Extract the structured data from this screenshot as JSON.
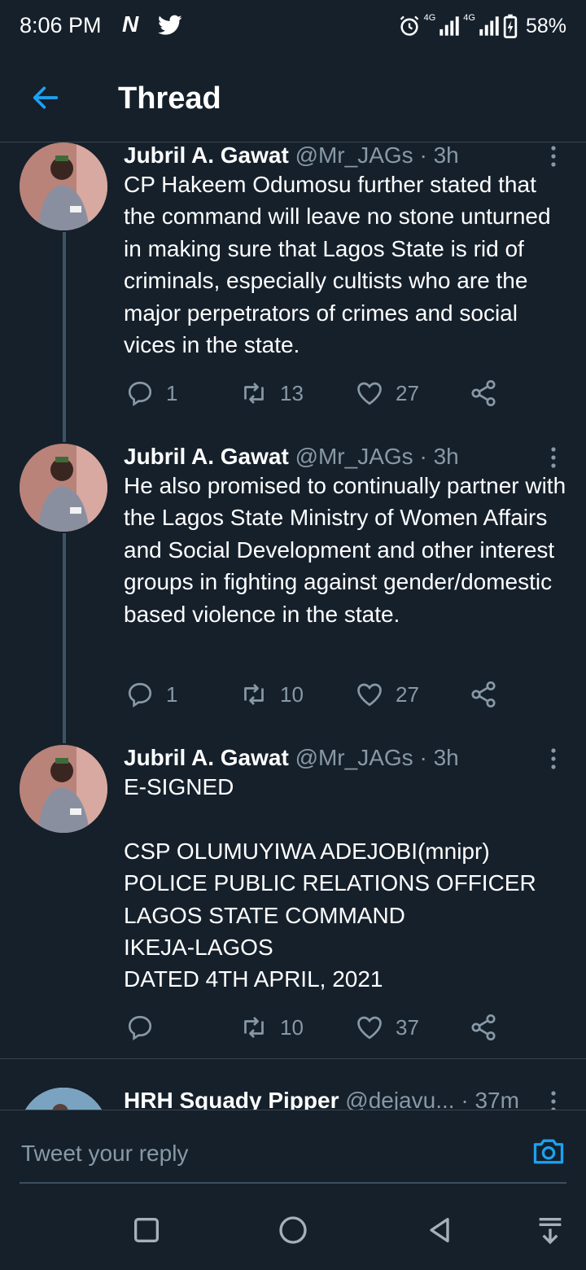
{
  "status_bar": {
    "time": "8:06 PM",
    "notif_n": "N",
    "net1": "4G",
    "net2": "4G",
    "battery": "58%"
  },
  "header": {
    "title": "Thread"
  },
  "tweets": [
    {
      "name": "Jubril A. Gawat",
      "handle": "@Mr_JAGs",
      "time": "3h",
      "text": "CP Hakeem Odumosu further stated that the command will leave no stone unturned in making sure that Lagos State is rid of criminals, especially cultists who are the major perpetrators of crimes and social vices in the state.",
      "replies": "1",
      "retweets": "13",
      "likes": "27"
    },
    {
      "name": "Jubril A. Gawat",
      "handle": "@Mr_JAGs",
      "time": "3h",
      "text": "He also promised to continually partner with the Lagos State Ministry of Women Affairs and Social Development and other interest groups in fighting against gender/domestic based violence in the state.",
      "replies": "1",
      "retweets": "10",
      "likes": "27"
    },
    {
      "name": "Jubril A. Gawat",
      "handle": "@Mr_JAGs",
      "time": "3h",
      "text": "E-SIGNED\n\nCSP OLUMUYIWA ADEJOBI(mnipr)\nPOLICE PUBLIC RELATIONS OFFICER\nLAGOS STATE COMMAND\nIKEJA-LAGOS\nDATED 4TH APRIL, 2021",
      "replies": "",
      "retweets": "10",
      "likes": "37"
    },
    {
      "name": "HRH Squady Pipper",
      "handle": "@dejavu...",
      "time": "37m"
    }
  ],
  "reply": {
    "placeholder": "Tweet your reply"
  },
  "colors": {
    "background": "#15202b",
    "accent": "#1da1f2",
    "muted": "#8899a6",
    "thread_line": "#3d5466"
  },
  "icons": [
    "back-arrow-icon",
    "more-vertical-icon",
    "reply-icon",
    "retweet-icon",
    "like-icon",
    "share-icon",
    "camera-icon",
    "recents-icon",
    "home-icon",
    "back-icon",
    "notification-pull-icon"
  ]
}
